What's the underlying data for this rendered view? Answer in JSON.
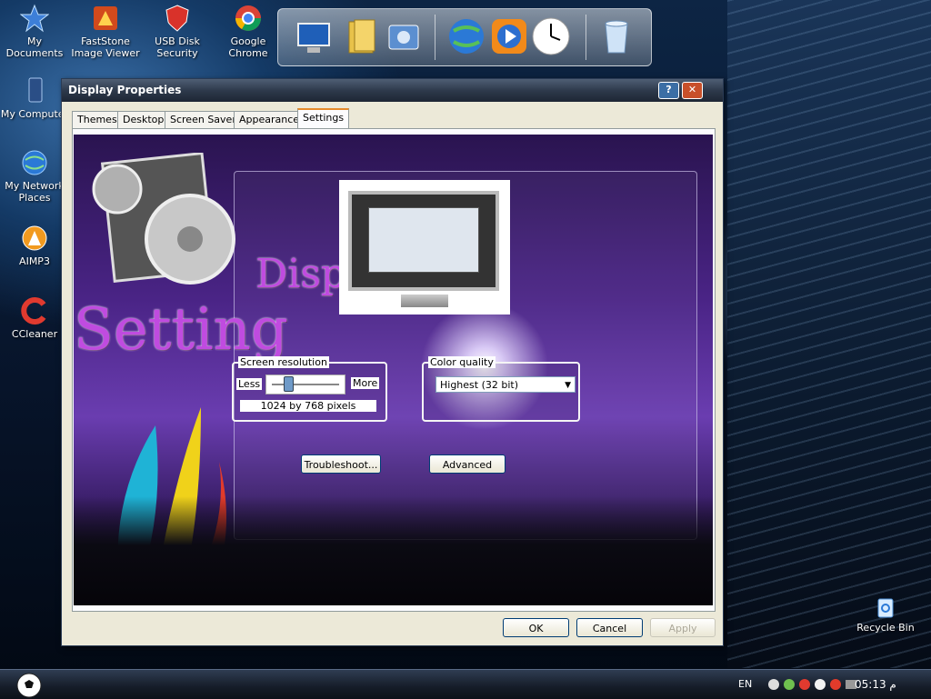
{
  "desktop": {
    "icons": [
      {
        "label": "My Documents",
        "icon": "star-icon"
      },
      {
        "label": "FastStone Image Viewer",
        "line1": "FastStone",
        "line2": "Image Viewer",
        "icon": "faststone-icon"
      },
      {
        "label": "USB Disk Security",
        "line1": "USB Disk",
        "line2": "Security",
        "icon": "usb-shield-icon"
      },
      {
        "label": "Google Chrome",
        "icon": "chrome-icon"
      },
      {
        "label": "My Computer",
        "icon": "computer-icon"
      },
      {
        "label": "My Network Places",
        "line1": "My Network",
        "line2": "Places",
        "icon": "globe-icon"
      },
      {
        "label": "AIMP3",
        "icon": "aimp-icon"
      },
      {
        "label": "CCleaner",
        "icon": "ccleaner-icon"
      },
      {
        "label": "Recycle Bin",
        "icon": "recycle-bin-icon"
      }
    ]
  },
  "dock": {
    "items": [
      "computer-icon",
      "folder-icon",
      "settings-icon",
      "globe-icon",
      "media-player-icon",
      "clock-icon",
      "trash-icon"
    ]
  },
  "window": {
    "title": "Display Properties",
    "help_glyph": "?",
    "close_glyph": "✕",
    "tabs": [
      {
        "label": "Themes",
        "active": false
      },
      {
        "label": "Desktop",
        "active": false
      },
      {
        "label": "Screen Saver",
        "active": false
      },
      {
        "label": "Appearance",
        "active": false
      },
      {
        "label": "Settings",
        "active": true
      }
    ],
    "decor_text": {
      "display": "Displ",
      "setting": "Setting"
    },
    "screen_resolution": {
      "label": "Screen resolution",
      "less": "Less",
      "more": "More",
      "value_text": "1024 by 768 pixels",
      "slider_fraction": 0.2
    },
    "color_quality": {
      "label": "Color quality",
      "selected": "Highest (32 bit)"
    },
    "buttons": {
      "troubleshoot": "Troubleshoot...",
      "advanced": "Advanced",
      "ok": "OK",
      "cancel": "Cancel",
      "apply": "Apply"
    }
  },
  "taskbar": {
    "language": "EN",
    "clock": "05:13 م"
  },
  "colors": {
    "title_bar": "#2e3a4c",
    "scene_purple": "#4a2486",
    "accent_orange": "#e68b2c"
  }
}
